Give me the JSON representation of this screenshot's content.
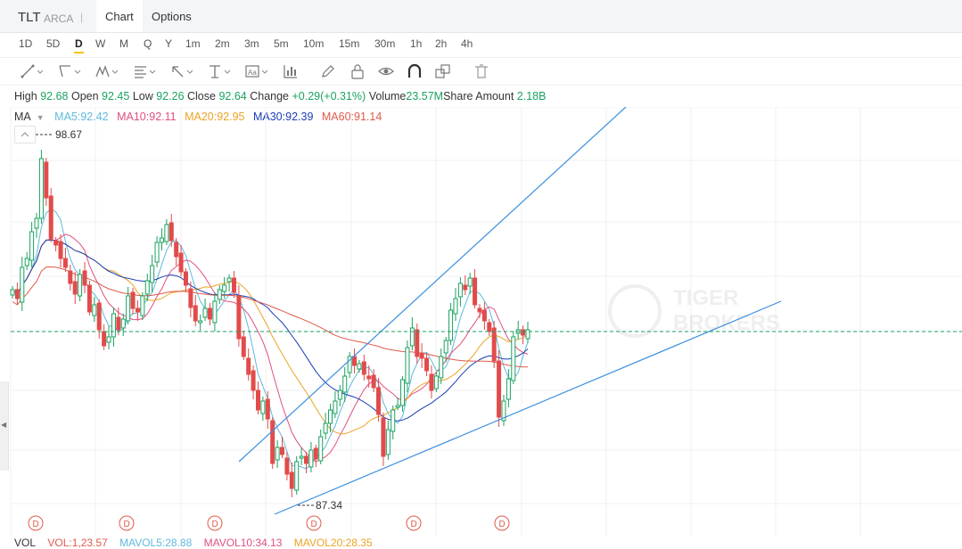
{
  "header": {
    "symbol": "TLT",
    "exchange": "ARCA",
    "divider": "|",
    "tabs": [
      "Chart",
      "Options"
    ]
  },
  "periods": [
    "1D",
    "5D",
    "D",
    "W",
    "M",
    "Q",
    "Y",
    "1m",
    "2m",
    "3m",
    "5m",
    "10m",
    "15m",
    "30m",
    "1h",
    "2h",
    "4h"
  ],
  "active_period": "D",
  "toolbar": {
    "icons": [
      "line-tool-icon",
      "channel-tool-icon",
      "pattern-tool-icon",
      "fib-tool-icon",
      "arrow-tool-icon",
      "measure-tool-icon",
      "text-tool-icon",
      "indicator-icon",
      "pencil-icon",
      "lock-icon",
      "eye-icon",
      "magnet-icon",
      "clone-icon",
      "trash-icon"
    ]
  },
  "quote": {
    "high_label": "High",
    "high": "92.68",
    "open_label": "Open",
    "open": "92.45",
    "low_label": "Low",
    "low": "92.26",
    "close_label": "Close",
    "close": "92.64",
    "change_label": "Change",
    "change": "+0.29(+0.31%)",
    "volume_label": "Volume",
    "volume": "23.57M",
    "share_amount_label": "Share Amount",
    "share_amount": "2.18B"
  },
  "ma_legend": {
    "label": "MA",
    "items": [
      {
        "text": "MA5:92.42",
        "color": "#5fb9dd"
      },
      {
        "text": "MA10:92.11",
        "color": "#e0507f"
      },
      {
        "text": "MA20:92.95",
        "color": "#eaa425"
      },
      {
        "text": "MA30:92.39",
        "color": "#1a3fb5"
      },
      {
        "text": "MA60:91.14",
        "color": "#e05a4a"
      }
    ]
  },
  "chart_data": {
    "type": "candlestick",
    "high_marker": "98.67",
    "low_marker": "87.34",
    "dividend_marker": "D",
    "last_price_line": true,
    "colors": {
      "up": "#1aa260",
      "down": "#e24b4b",
      "trendline": "#3a8ee0"
    }
  },
  "watermark": {
    "line1": "TIGER",
    "line2": "BROKERS"
  },
  "volume_row": {
    "label": "VOL",
    "items": [
      {
        "text": "VOL:1,23.57",
        "color": "#e05a4a"
      },
      {
        "text": "MAVOL5:28.88",
        "color": "#5fb9dd"
      },
      {
        "text": "MAVOL10:34.13",
        "color": "#e0507f"
      },
      {
        "text": "MAVOL20:28.35",
        "color": "#eaa425"
      }
    ]
  }
}
